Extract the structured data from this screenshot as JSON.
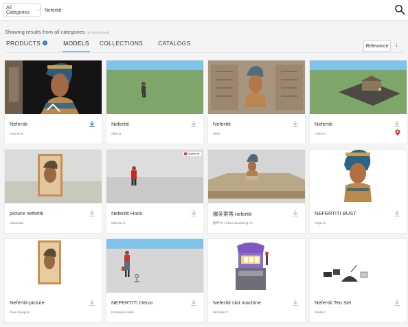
{
  "search": {
    "category": "All Categories",
    "query": "Nefertiti"
  },
  "results": {
    "summary": "Showing results from all categories",
    "count": "(20 items found)"
  },
  "tabs": [
    {
      "label": "PRODUCTS"
    },
    {
      "label": "MODELS",
      "active": true
    },
    {
      "label": "COLLECTIONS"
    },
    {
      "label": "CATALOGS"
    }
  ],
  "sort": {
    "label": "Relevance",
    "direction_icon": "arrow-down-icon"
  },
  "accent_color": "#1976d2",
  "cards": [
    {
      "title": "Nefertiti",
      "author": "Antonio R.",
      "download_highlight": true
    },
    {
      "title": "Nefertiti",
      "author": "Alain B."
    },
    {
      "title": "Nefertiti",
      "author": "isidro"
    },
    {
      "title": "Nefertiti",
      "author": "Carlos C.",
      "location_pin": true
    },
    {
      "title": "picture nefertiti",
      "author": "rubiounda"
    },
    {
      "title": "Nefertiti Hock",
      "author": "Meichor H.",
      "badge": "SketchUp"
    },
    {
      "title": "娜芙蒂蒂 nefertiti",
      "author": "創作TV / Chen Guocheng TV"
    },
    {
      "title": "NEFERTITI BUST",
      "author": "Tioge G."
    },
    {
      "title": "Nefertiti-picture",
      "author": "Casa Designer"
    },
    {
      "title": "NEFERTITI Decor",
      "author": "Fernando Kestin"
    },
    {
      "title": "Nefertiti slot machine",
      "author": "Nicholas F."
    },
    {
      "title": "Nefertiti Teo Set",
      "author": "Sarah J."
    }
  ]
}
